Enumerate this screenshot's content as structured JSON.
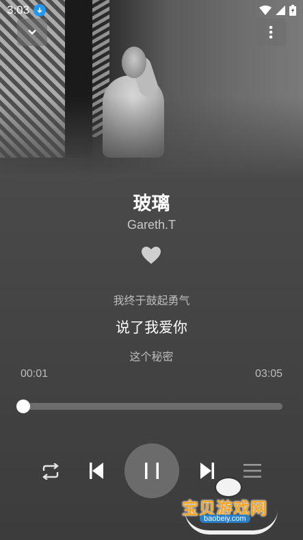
{
  "status_bar": {
    "time": "3:03"
  },
  "song": {
    "title": "玻璃",
    "artist": "Gareth.T",
    "liked": true
  },
  "lyrics": {
    "previous": "我终于鼓起勇气",
    "current": "说了我爱你",
    "next": "这个秘密"
  },
  "playback": {
    "elapsed": "00:01",
    "duration": "03:05",
    "progress": 0.005,
    "state": "playing"
  },
  "icons": {
    "collapse": "chevron-down-icon",
    "more": "more-vertical-icon",
    "like": "heart-icon",
    "repeat": "repeat-icon",
    "previous": "skip-previous-icon",
    "pause": "pause-icon",
    "next": "skip-next-icon",
    "playlist": "playlist-icon"
  },
  "watermark": {
    "text": "宝贝游戏网",
    "url": "baobeiy.com"
  },
  "colors": {
    "background": "#474747",
    "accent": "#ffffff",
    "dim_text": "#bdbdbd"
  }
}
